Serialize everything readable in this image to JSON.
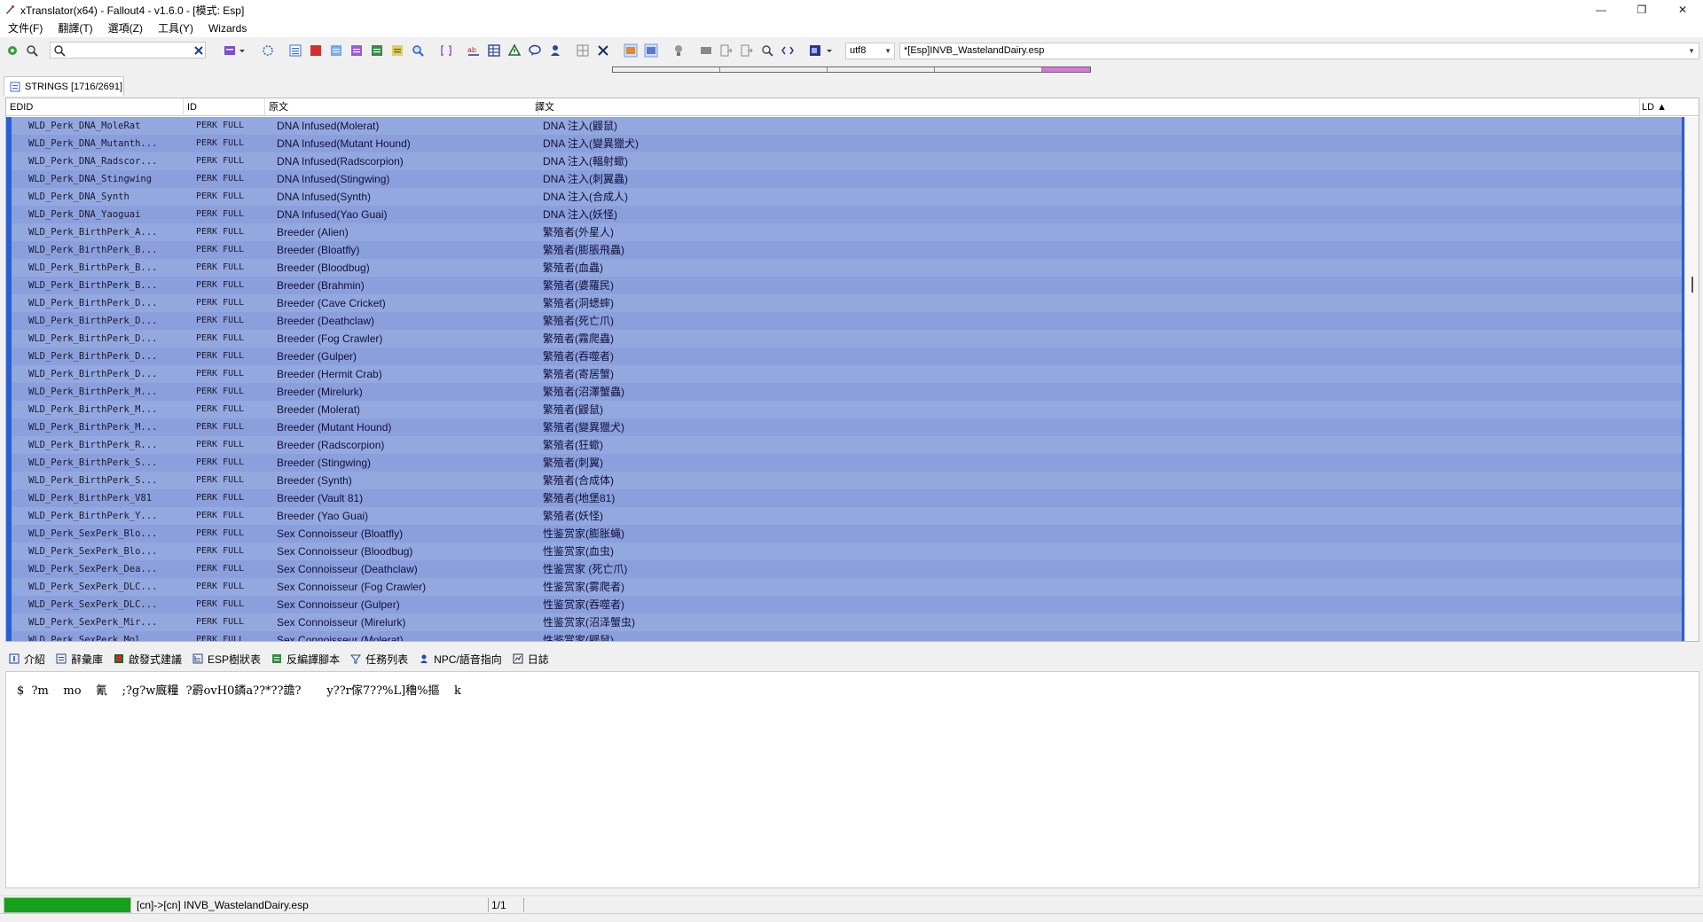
{
  "window": {
    "title": "xTranslator(x64) - Fallout4 - v1.6.0 - [模式: Esp]",
    "min_label": "—",
    "max_label": "❐",
    "close_label": "✕"
  },
  "menu": [
    "文件(F)",
    "翻譯(T)",
    "選項(Z)",
    "工具(Y)",
    "Wizards"
  ],
  "toolbar": {
    "search_value": "",
    "encoding": "utf8",
    "file": "*[Esp]INVB_WastelandDairy.esp"
  },
  "doc_tab": {
    "label": "STRINGS [1716/2691]"
  },
  "table": {
    "headers": {
      "edid": "EDID",
      "id": "ID",
      "source": "原文",
      "dest": "譯文",
      "ld": "LD ▲"
    },
    "rows": [
      {
        "edid": "WLD_Perk_DNA_MoleRat",
        "id": "PERK FULL",
        "src": "DNA Infused(Molerat)",
        "dst": "DNA 注入(鼹鼠)"
      },
      {
        "edid": "WLD_Perk_DNA_Mutanth...",
        "id": "PERK FULL",
        "src": "DNA Infused(Mutant Hound)",
        "dst": "DNA 注入(變異獵犬)"
      },
      {
        "edid": "WLD_Perk_DNA_Radscor...",
        "id": "PERK FULL",
        "src": "DNA Infused(Radscorpion)",
        "dst": "DNA 注入(輻射蠍)"
      },
      {
        "edid": "WLD_Perk_DNA_Stingwing",
        "id": "PERK FULL",
        "src": "DNA Infused(Stingwing)",
        "dst": "DNA 注入(刺翼蟲)"
      },
      {
        "edid": "WLD_Perk_DNA_Synth",
        "id": "PERK FULL",
        "src": "DNA Infused(Synth)",
        "dst": "DNA 注入(合成人)"
      },
      {
        "edid": "WLD_Perk_DNA_Yaoguai",
        "id": "PERK FULL",
        "src": "DNA Infused(Yao Guai)",
        "dst": "DNA 注入(妖怪)"
      },
      {
        "edid": "WLD_Perk_BirthPerk_A...",
        "id": "PERK FULL",
        "src": "Breeder (Alien)",
        "dst": "繁殖者(外星人)"
      },
      {
        "edid": "WLD_Perk_BirthPerk_B...",
        "id": "PERK FULL",
        "src": "Breeder (Bloatfly)",
        "dst": "繁殖者(膨脹飛蟲)"
      },
      {
        "edid": "WLD_Perk_BirthPerk_B...",
        "id": "PERK FULL",
        "src": "Breeder (Bloodbug)",
        "dst": "繁殖者(血蟲)"
      },
      {
        "edid": "WLD_Perk_BirthPerk_B...",
        "id": "PERK FULL",
        "src": "Breeder (Brahmin)",
        "dst": "繁殖者(婆羅民)"
      },
      {
        "edid": "WLD_Perk_BirthPerk_D...",
        "id": "PERK FULL",
        "src": "Breeder (Cave Cricket)",
        "dst": "繁殖者(洞蟋蟀)"
      },
      {
        "edid": "WLD_Perk_BirthPerk_D...",
        "id": "PERK FULL",
        "src": "Breeder (Deathclaw)",
        "dst": "繁殖者(死亡爪)"
      },
      {
        "edid": "WLD_Perk_BirthPerk_D...",
        "id": "PERK FULL",
        "src": "Breeder (Fog Crawler)",
        "dst": "繁殖者(霧爬蟲)"
      },
      {
        "edid": "WLD_Perk_BirthPerk_D...",
        "id": "PERK FULL",
        "src": "Breeder (Gulper)",
        "dst": "繁殖者(吞噬者)"
      },
      {
        "edid": "WLD_Perk_BirthPerk_D...",
        "id": "PERK FULL",
        "src": "Breeder (Hermit Crab)",
        "dst": "繁殖者(寄居蟹)"
      },
      {
        "edid": "WLD_Perk_BirthPerk_M...",
        "id": "PERK FULL",
        "src": "Breeder (Mirelurk)",
        "dst": "繁殖者(沼澤蟹蟲)"
      },
      {
        "edid": "WLD_Perk_BirthPerk_M...",
        "id": "PERK FULL",
        "src": "Breeder (Molerat)",
        "dst": "繁殖者(鼹鼠)"
      },
      {
        "edid": "WLD_Perk_BirthPerk_M...",
        "id": "PERK FULL",
        "src": "Breeder (Mutant Hound)",
        "dst": "繁殖者(變異獵犬)"
      },
      {
        "edid": "WLD_Perk_BirthPerk_R...",
        "id": "PERK FULL",
        "src": "Breeder (Radscorpion)",
        "dst": "繁殖者(狂蠍)"
      },
      {
        "edid": "WLD_Perk_BirthPerk_S...",
        "id": "PERK FULL",
        "src": "Breeder (Stingwing)",
        "dst": "繁殖者(刺翼)"
      },
      {
        "edid": "WLD_Perk_BirthPerk_S...",
        "id": "PERK FULL",
        "src": "Breeder (Synth)",
        "dst": "繁殖者(合成体)"
      },
      {
        "edid": "WLD_Perk_BirthPerk_V81",
        "id": "PERK FULL",
        "src": "Breeder (Vault 81)",
        "dst": "繁殖者(地堡81)"
      },
      {
        "edid": "WLD_Perk_BirthPerk_Y...",
        "id": "PERK FULL",
        "src": "Breeder (Yao Guai)",
        "dst": "繁殖者(妖怪)"
      },
      {
        "edid": "WLD_Perk_SexPerk_Blo...",
        "id": "PERK FULL",
        "src": "Sex Connoisseur (Bloatfly)",
        "dst": "性鉴赏家(膨胀蝇)"
      },
      {
        "edid": "WLD_Perk_SexPerk_Blo...",
        "id": "PERK FULL",
        "src": "Sex Connoisseur (Bloodbug)",
        "dst": "性鉴赏家(血虫)"
      },
      {
        "edid": "WLD_Perk_SexPerk_Dea...",
        "id": "PERK FULL",
        "src": "Sex Connoisseur (Deathclaw)",
        "dst": "性鉴赏家 (死亡爪)"
      },
      {
        "edid": "WLD_Perk_SexPerk_DLC...",
        "id": "PERK FULL",
        "src": "Sex Connoisseur (Fog Crawler)",
        "dst": "性鉴赏家(雾爬者)"
      },
      {
        "edid": "WLD_Perk_SexPerk_DLC...",
        "id": "PERK FULL",
        "src": "Sex Connoisseur (Gulper)",
        "dst": "性鉴赏家(吞噬者)"
      },
      {
        "edid": "WLD_Perk_SexPerk_Mir...",
        "id": "PERK FULL",
        "src": "Sex Connoisseur (Mirelurk)",
        "dst": "性鉴赏家(沼泽蟹虫)"
      },
      {
        "edid": "WLD_Perk_SexPerk_Mol...",
        "id": "PERK FULL",
        "src": "Sex Connoisseur (Molerat)",
        "dst": "性鉴赏家(鼹鼠)"
      }
    ]
  },
  "bottom_tabs": [
    "介紹",
    "辭彙庫",
    "啟發式建議",
    "ESP樹狀表",
    "反編譯腳本",
    "任務列表",
    "NPC/語音指向",
    "日誌"
  ],
  "text_panel": {
    "content": "$  ?m    mo    氰    ;?g?w廐糧  ?霨ovH0鏻a??*??譫?       y??r傢7??%L]穭%摳    k"
  },
  "status": {
    "file": "[cn]->[cn] INVB_WastelandDairy.esp",
    "pager": "1/1",
    "progress": 1.0
  },
  "colors": {
    "row_bg": "#94a8e0",
    "row_edge": "#2a5fd1",
    "progress": "#16a11a",
    "strip_highlight": "#e070e0"
  }
}
